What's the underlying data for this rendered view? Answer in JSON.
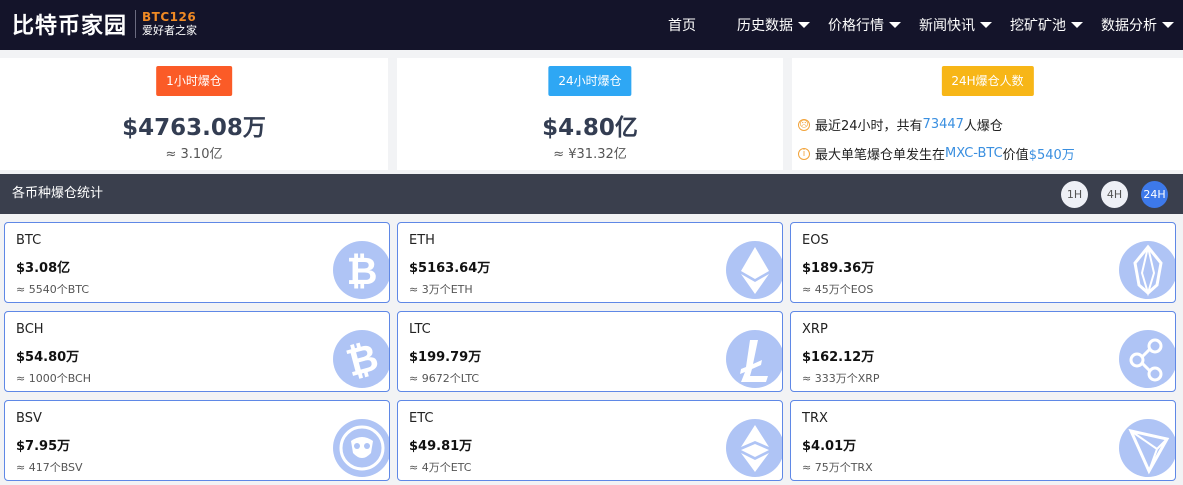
{
  "header": {
    "logo_main": "比特币家园",
    "logo_brand": "BTC126",
    "logo_tag": "爱好者之家",
    "nav": [
      {
        "label": "首页",
        "dropdown": false
      },
      {
        "label": "历史数据",
        "dropdown": true
      },
      {
        "label": "价格行情",
        "dropdown": true
      },
      {
        "label": "新闻快讯",
        "dropdown": true
      },
      {
        "label": "挖矿矿池",
        "dropdown": true
      },
      {
        "label": "数据分析",
        "dropdown": true
      }
    ]
  },
  "stats": {
    "hour1": {
      "badge": "1小时爆仓",
      "value": "$4763.08万",
      "sub": "≈ 3.10亿"
    },
    "hour24": {
      "badge": "24小时爆仓",
      "value": "$4.80亿",
      "sub": "≈ ¥31.32亿"
    },
    "people24": {
      "badge": "24H爆仓人数",
      "line1_prefix": "最近24小时，共有",
      "line1_count": "73447",
      "line1_suffix": "人爆仓",
      "line2_prefix": "最大单笔爆仓单发生在",
      "line2_pair": "MXC-BTC",
      "line2_mid": "价值",
      "line2_value": "$540万"
    }
  },
  "section": {
    "title": "各币种爆仓统计",
    "timeframes": [
      "1H",
      "4H",
      "24H"
    ],
    "active_timeframe": "24H"
  },
  "coins": [
    {
      "symbol": "BTC",
      "amount": "$3.08亿",
      "qty": "≈ 5540个BTC",
      "icon": "bitcoin-icon"
    },
    {
      "symbol": "ETH",
      "amount": "$5163.64万",
      "qty": "≈ 3万个ETH",
      "icon": "ethereum-icon"
    },
    {
      "symbol": "EOS",
      "amount": "$189.36万",
      "qty": "≈ 45万个EOS",
      "icon": "eos-icon"
    },
    {
      "symbol": "BCH",
      "amount": "$54.80万",
      "qty": "≈ 1000个BCH",
      "icon": "bitcoin-cash-icon"
    },
    {
      "symbol": "LTC",
      "amount": "$199.79万",
      "qty": "≈ 9672个LTC",
      "icon": "litecoin-icon"
    },
    {
      "symbol": "XRP",
      "amount": "$162.12万",
      "qty": "≈ 333万个XRP",
      "icon": "ripple-icon"
    },
    {
      "symbol": "BSV",
      "amount": "$7.95万",
      "qty": "≈ 417个BSV",
      "icon": "bitcoin-sv-icon"
    },
    {
      "symbol": "ETC",
      "amount": "$49.81万",
      "qty": "≈ 4万个ETC",
      "icon": "ethereum-classic-icon"
    },
    {
      "symbol": "TRX",
      "amount": "$4.01万",
      "qty": "≈ 75万个TRX",
      "icon": "tron-icon"
    }
  ],
  "colors": {
    "header_bg": "#14142a",
    "brand_orange": "#f08a24",
    "badge_orange": "#fb5b27",
    "badge_blue": "#2ea7f4",
    "badge_yellow": "#f7b617",
    "section_bar": "#3a3f4d",
    "active_blue": "#3d79ea",
    "card_border": "#5f88e6",
    "coin_fill": "#afc4f5",
    "link": "#3a8fe0"
  }
}
